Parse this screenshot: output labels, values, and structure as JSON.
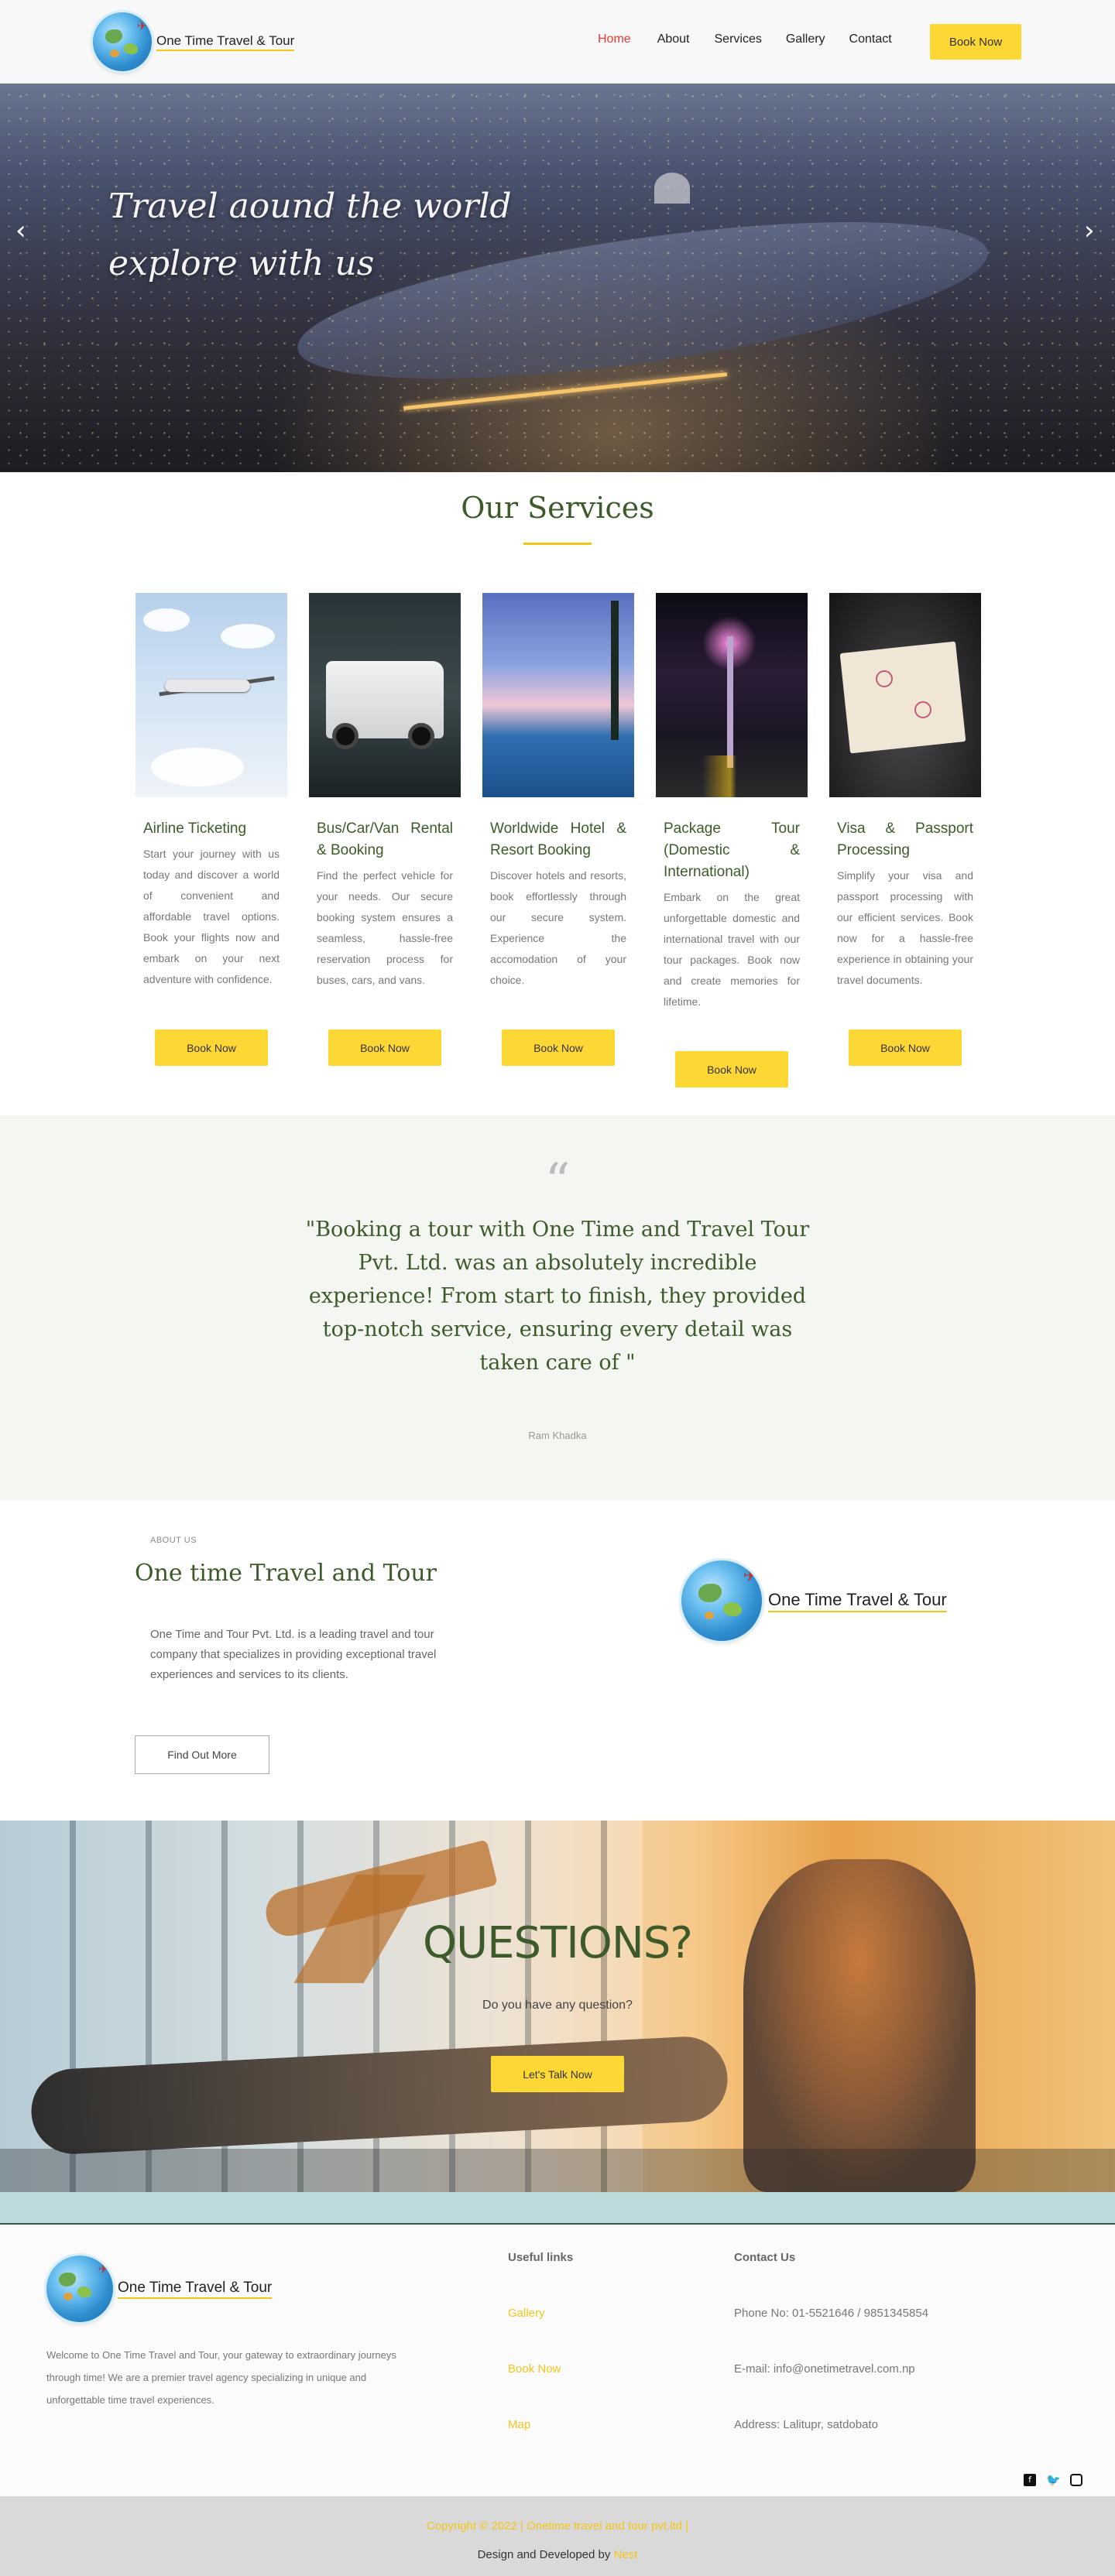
{
  "brand": {
    "name": "One Time Travel & Tour"
  },
  "nav": {
    "items": [
      {
        "label": "Home",
        "active": true
      },
      {
        "label": "About",
        "active": false
      },
      {
        "label": "Services",
        "active": false
      },
      {
        "label": "Gallery",
        "active": false
      },
      {
        "label": "Contact",
        "active": false
      }
    ],
    "book_label": "Book Now"
  },
  "hero": {
    "title_line1": "Travel aound the world",
    "title_line2": "explore with us",
    "prev_icon": "chevron-left-icon",
    "next_icon": "chevron-right-icon"
  },
  "services": {
    "title": "Our Services",
    "cards": [
      {
        "title": "Airline Ticketing",
        "text": "Start your journey with us today and discover a world of convenient and affordable travel options. Book your flights now and embark on your next adventure with confidence.",
        "button": "Book Now"
      },
      {
        "title": "Bus/Car/Van Rental & Booking",
        "text": "Find the perfect vehicle for your needs. Our secure booking system ensures a seamless, hassle-free reservation process for buses, cars, and vans.",
        "button": "Book Now"
      },
      {
        "title": "Worldwide Hotel & Resort Booking",
        "text": "Discover hotels and resorts, book effortlessly through our secure system. Experience the accomodation of your choice.",
        "button": "Book Now"
      },
      {
        "title": "Package Tour (Domestic & International)",
        "text": "Embark on the great unforgettable domestic and international travel with our tour packages. Book now and create memories for lifetime.",
        "button": "Book Now"
      },
      {
        "title": "Visa & Passport Processing",
        "text": "Simplify your visa and passport processing with our efficient services. Book now for a hassle-free experience in obtaining your travel documents.",
        "button": "Book Now"
      }
    ]
  },
  "testimonial": {
    "quote_mark": "“",
    "text": "\"Booking a tour with One Time and Travel Tour Pvt. Ltd. was an absolutely incredible experience! From start to finish, they provided top-notch service, ensuring every detail was taken care of \"",
    "author": "Ram Khadka"
  },
  "about": {
    "eyebrow": "ABOUT US",
    "title": "One time Travel and Tour",
    "text": "One Time and Tour Pvt. Ltd. is a leading travel and tour company that specializes in providing exceptional travel experiences and services to its clients.",
    "button": "Find Out More"
  },
  "cta": {
    "title": "QUESTIONS?",
    "subtitle": "Do you have any question?",
    "button": "Let's Talk Now"
  },
  "footer": {
    "about": "Welcome to One Time Travel and Tour, your gateway to extraordinary journeys through time! We are a premier travel agency specializing in unique and unforgettable time travel experiences.",
    "useful_links_title": "Useful links",
    "links": [
      "Gallery",
      "Book Now",
      "Map"
    ],
    "contact_title": "Contact Us",
    "phone": "Phone No: 01-5521646 / 9851345854",
    "email": "E-mail: info@onetimetravel.com.np",
    "address": "Address: Lalitupr, satdobato",
    "social_icons": [
      "facebook-icon",
      "twitter-icon",
      "instagram-icon"
    ],
    "copyright": "Copyright © 2022 | Onetime travel and tour pvt.ltd |",
    "developed_prefix": "Design and Developed by",
    "developed_by": "Nest"
  },
  "colors": {
    "accent_yellow": "#fdd835",
    "title_green": "#3d5a2a",
    "active_red": "#e53935"
  }
}
